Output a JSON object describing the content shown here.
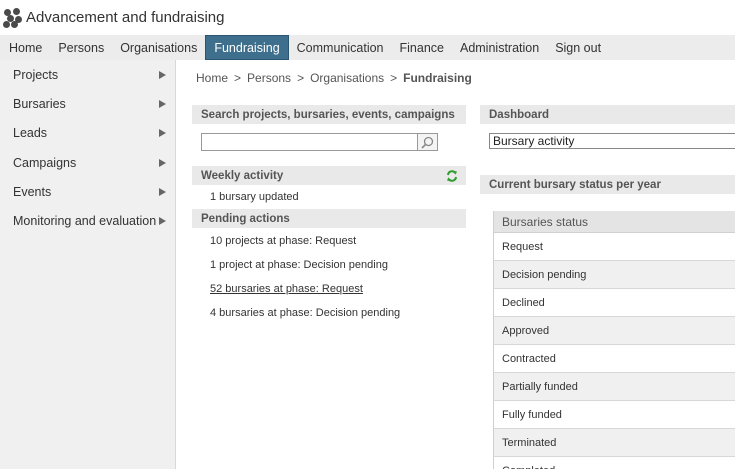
{
  "app": {
    "title": "Advancement and fundraising"
  },
  "topnav": [
    {
      "label": "Home",
      "active": false
    },
    {
      "label": "Persons",
      "active": false
    },
    {
      "label": "Organisations",
      "active": false
    },
    {
      "label": "Fundraising",
      "active": true
    },
    {
      "label": "Communication",
      "active": false
    },
    {
      "label": "Finance",
      "active": false
    },
    {
      "label": "Administration",
      "active": false
    },
    {
      "label": "Sign out",
      "active": false
    }
  ],
  "sidebar": {
    "items": [
      {
        "label": "Projects"
      },
      {
        "label": "Bursaries"
      },
      {
        "label": "Leads"
      },
      {
        "label": "Campaigns"
      },
      {
        "label": "Events"
      },
      {
        "label": "Monitoring and evaluation"
      }
    ]
  },
  "breadcrumb": {
    "items": [
      "Home",
      "Persons",
      "Organisations"
    ],
    "separator": ">",
    "current": "Fundraising"
  },
  "search": {
    "header": "Search projects, bursaries, events, campaigns",
    "value": "",
    "placeholder": ""
  },
  "weekly": {
    "header": "Weekly activity",
    "items": [
      "1 bursary updated"
    ]
  },
  "pending": {
    "header": "Pending actions",
    "items": [
      {
        "text": "10 projects at phase: Request",
        "link": false
      },
      {
        "text": "1 project at phase: Decision pending",
        "link": false
      },
      {
        "text": "52 bursaries at phase: Request",
        "link": true
      },
      {
        "text": "4 bursaries at phase: Decision pending",
        "link": false
      }
    ]
  },
  "dashboard": {
    "header": "Dashboard",
    "selected": "Bursary activity"
  },
  "status": {
    "header": "Current bursary status per year",
    "table_header": "Bursaries status",
    "rows": [
      "Request",
      "Decision pending",
      "Declined",
      "Approved",
      "Contracted",
      "Partially funded",
      "Fully funded",
      "Terminated",
      "Completed"
    ]
  },
  "colors": {
    "nav_active_bg": "#3e6f8c",
    "refresh_icon": "#2e9c2e"
  }
}
